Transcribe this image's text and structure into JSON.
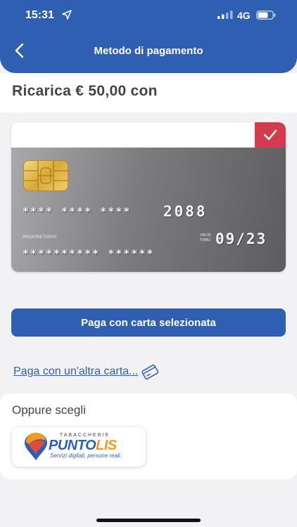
{
  "status_bar": {
    "time": "15:31",
    "network": "4G"
  },
  "header": {
    "title": "Metodo di pagamento",
    "color": "#2f5fb3"
  },
  "recharge": {
    "title": "Ricarica € 50,00 con"
  },
  "card": {
    "number_masked": "**** **** ****",
    "last4": "2088",
    "owner_label": "PROPRIETARIO",
    "valid_label": "VALID THRU",
    "expiry": "09/23",
    "owner_masked": "********** ******",
    "selected": true,
    "check_color": "#d43b4f"
  },
  "actions": {
    "pay_selected_label": "Paga con carta selezionata",
    "other_card_label": "Paga con un'altra carta..."
  },
  "alternatives": {
    "title": "Oppure scegli",
    "logo": {
      "top_text": "TABACCHERIE",
      "brand_part1": "PUNTO",
      "brand_part2": "LIS",
      "tagline": "Servizi digitali, persone reali."
    }
  }
}
